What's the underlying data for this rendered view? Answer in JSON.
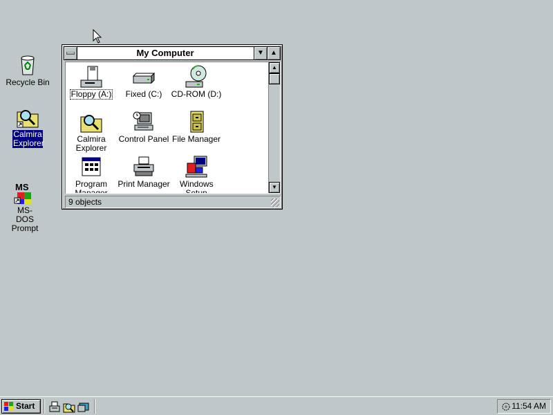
{
  "desktop": {
    "icons": [
      {
        "label": "Recycle Bin",
        "icon": "recycle-bin-icon"
      },
      {
        "label": "Calmira Explorer",
        "icon": "calmira-explorer-icon"
      },
      {
        "label": "MS-DOS Prompt",
        "icon": "ms-dos-prompt-icon"
      }
    ]
  },
  "window": {
    "title": "My Computer",
    "items": [
      {
        "label": "Floppy (A:)",
        "icon": "floppy-drive-icon"
      },
      {
        "label": "Fixed (C:)",
        "icon": "hard-drive-icon"
      },
      {
        "label": "CD-ROM (D:)",
        "icon": "cdrom-icon"
      },
      {
        "label": "Calmira Explorer",
        "icon": "calmira-explorer-icon"
      },
      {
        "label": "Control Panel",
        "icon": "control-panel-icon"
      },
      {
        "label": "File Manager",
        "icon": "file-manager-icon"
      },
      {
        "label": "Program Manager",
        "icon": "program-manager-icon"
      },
      {
        "label": "Print Manager",
        "icon": "print-manager-icon"
      },
      {
        "label": "Windows Setup",
        "icon": "windows-setup-icon"
      }
    ],
    "status": "9 objects"
  },
  "taskbar": {
    "start_label": "Start",
    "clock": "11:54 AM"
  },
  "colors": {
    "desktop": "#c0c7c8",
    "selection": "#000080"
  }
}
